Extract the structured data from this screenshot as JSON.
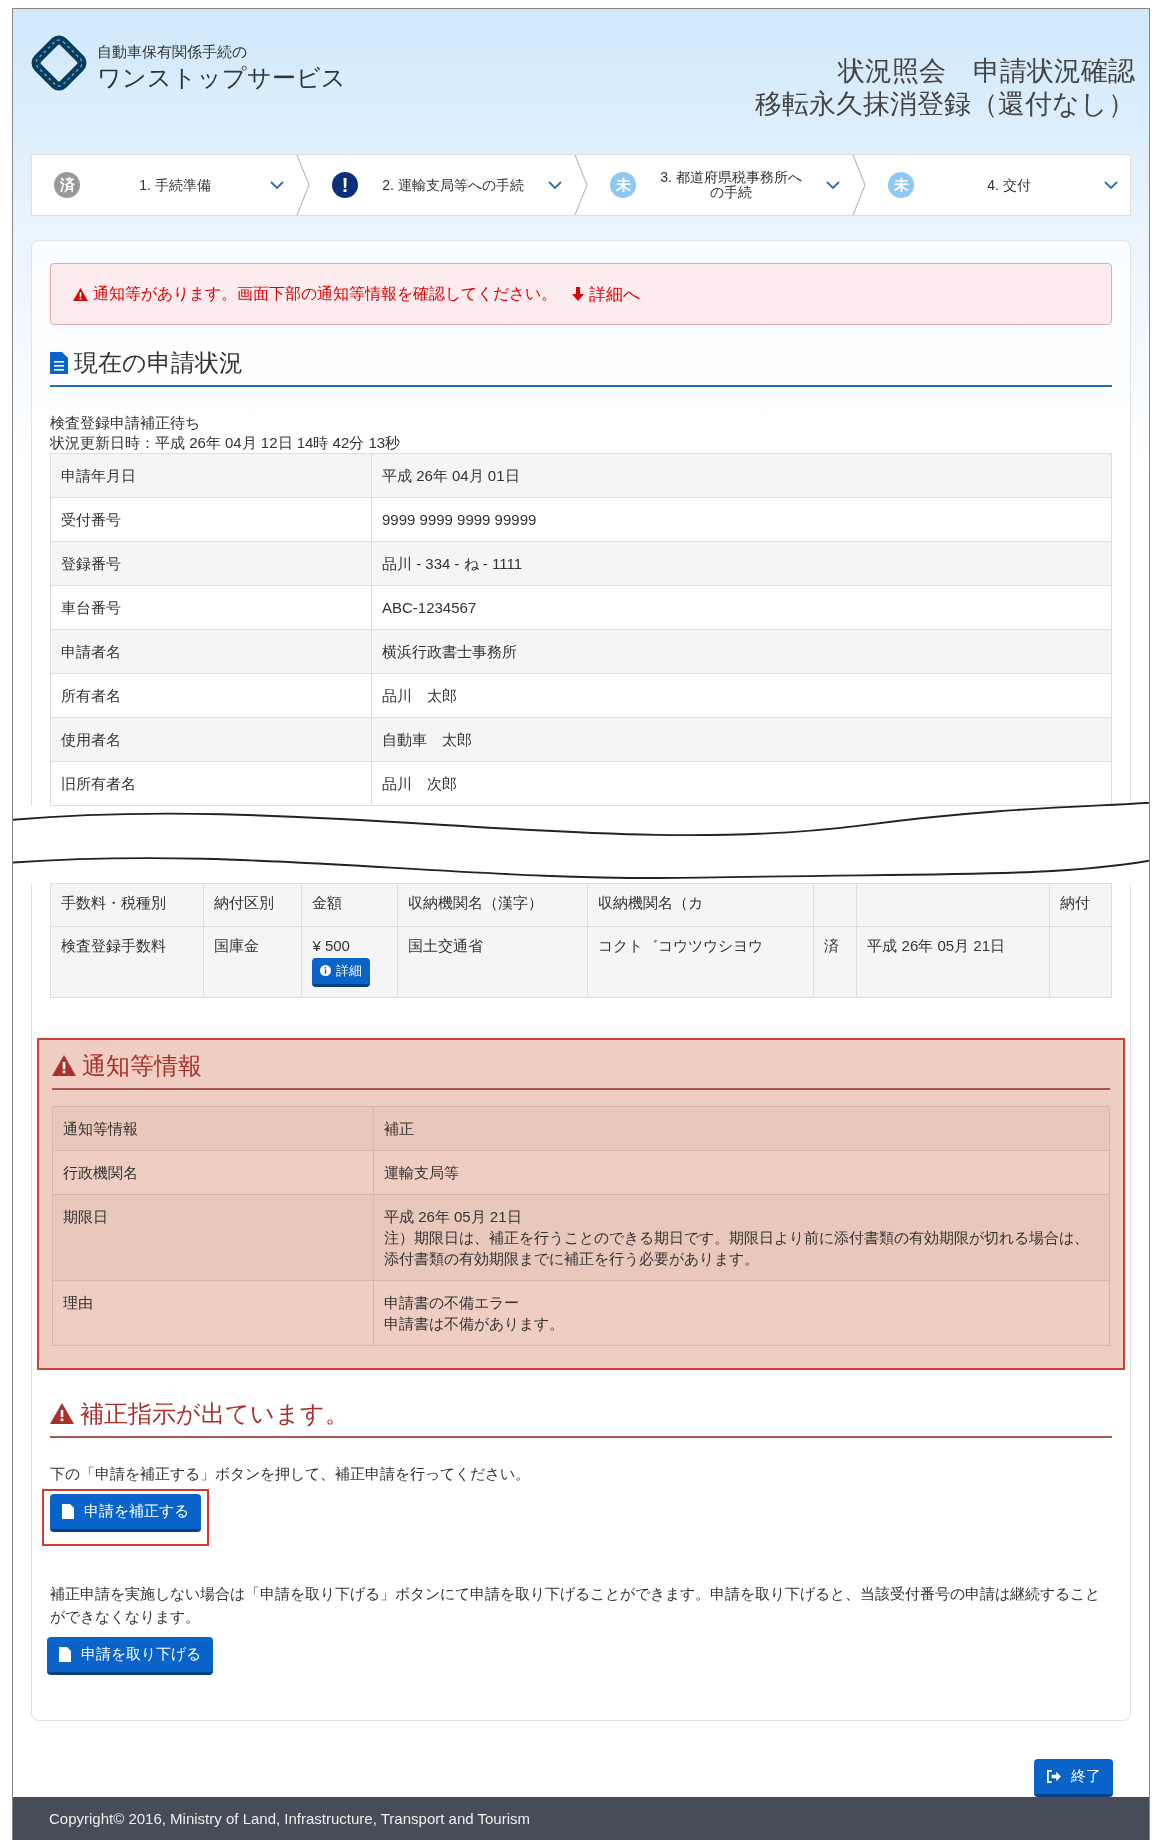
{
  "header": {
    "logo_caption": "自動車保有関係手続の",
    "logo_title": "ワンストップサービス",
    "title_lines": [
      "状況照会　申請状況確認",
      "移転永久抹消登録（還付なし）"
    ]
  },
  "steps": [
    {
      "badge": "済",
      "kind": "done",
      "label": "1. 手続準備"
    },
    {
      "badge": "!",
      "kind": "alert",
      "label": "2. 運輸支局等への手続"
    },
    {
      "badge": "未",
      "kind": "pending",
      "label": "3. 都道府県税事務所への手続"
    },
    {
      "badge": "未",
      "kind": "pending",
      "label": "4. 交付"
    }
  ],
  "alert": {
    "message": "通知等があります。画面下部の通知等情報を確認してください。",
    "link": "詳細へ"
  },
  "status_section": {
    "title": "現在の申請状況",
    "status": "検査登録申請補正待ち",
    "updated": "状況更新日時：平成 26年 04月 12日 14時 42分 13秒",
    "rows": [
      {
        "label": "申請年月日",
        "value": "平成 26年 04月 01日"
      },
      {
        "label": "受付番号",
        "value": "9999 9999 9999 99999"
      },
      {
        "label": "登録番号",
        "value": "品川 - 334 - ね - 1111"
      },
      {
        "label": "車台番号",
        "value": "ABC-1234567"
      },
      {
        "label": "申請者名",
        "value": "横浜行政書士事務所"
      },
      {
        "label": "所有者名",
        "value": "品川　太郎"
      },
      {
        "label": "使用者名",
        "value": "自動車　太郎"
      },
      {
        "label": "旧所有者名",
        "value": "品川　次郎"
      }
    ]
  },
  "fees_table": {
    "columns": [
      "手数料・税種別",
      "納付区別",
      "金額",
      "収納機関名（漢字）",
      "収納機関名（カ",
      null,
      null,
      "納付"
    ],
    "rows": [
      {
        "cells": [
          "検査登録手数料",
          "国庫金",
          "¥ 500",
          "国土交通省",
          "コクト゛コウツウシヨウ",
          "済",
          "平成 26年 05月 21日",
          null
        ],
        "detail_button": "詳細"
      }
    ]
  },
  "notice_section": {
    "title": "通知等情報",
    "rows": [
      {
        "label": "通知等情報",
        "lines": [
          "補正"
        ]
      },
      {
        "label": "行政機関名",
        "lines": [
          "運輸支局等"
        ]
      },
      {
        "label": "期限日",
        "lines": [
          "平成 26年 05月 21日",
          "注）期限日は、補正を行うことのできる期日です。期限日より前に添付書類の有効期限が切れる場合は、添付書類の有効期限までに補正を行う必要があります。"
        ]
      },
      {
        "label": "理由",
        "lines": [
          "申請書の不備エラー",
          "申請書は不備があります。"
        ]
      }
    ]
  },
  "correction_section": {
    "title": "補正指示が出ています。",
    "actions": [
      {
        "text": "下の「申請を補正する」ボタンを押して、補正申請を行ってください。",
        "button": "申請を補正する",
        "highlighted": true
      },
      {
        "text": "補正申請を実施しない場合は「申請を取り下げる」ボタンにて申請を取り下げることができます。申請を取り下げると、当該受付番号の申請は継続することができなくなります。",
        "button": "申請を取り下げる",
        "highlighted": false
      }
    ]
  },
  "end_button": "終了",
  "footer": "Copyright© 2016, Ministry of Land, Infrastructure, Transport and Tourism"
}
